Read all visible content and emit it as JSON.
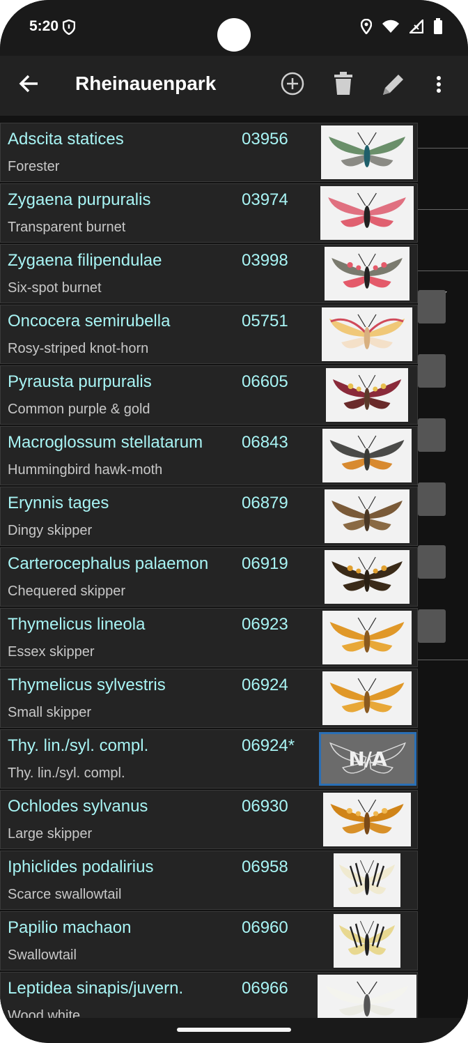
{
  "status": {
    "time": "5:20"
  },
  "toolbar": {
    "title": "Rheinauenpark"
  },
  "colors": {
    "accent_text": "#a8f4f4",
    "selection_border": "#2a6fb5"
  },
  "species": [
    {
      "scientific": "Adscita statices",
      "code": "03956",
      "common": "Forester",
      "image": "moth-green"
    },
    {
      "scientific": "Zygaena purpuralis",
      "code": "03974",
      "common": "Transparent burnet",
      "image": "moth-red"
    },
    {
      "scientific": "Zygaena filipendulae",
      "code": "03998",
      "common": "Six-spot burnet",
      "image": "moth-red-spots"
    },
    {
      "scientific": "Oncocera semirubella",
      "code": "05751",
      "common": "Rosy-striped knot-horn",
      "image": "moth-pink-yellow"
    },
    {
      "scientific": "Pyrausta purpuralis",
      "code": "06605",
      "common": "Common purple & gold",
      "image": "moth-purple-gold"
    },
    {
      "scientific": "Macroglossum stellatarum",
      "code": "06843",
      "common": "Hummingbird hawk-moth",
      "image": "moth-grey-brown"
    },
    {
      "scientific": "Erynnis tages",
      "code": "06879",
      "common": "Dingy skipper",
      "image": "skipper-brown"
    },
    {
      "scientific": "Carterocephalus palaemon",
      "code": "06919",
      "common": "Chequered skipper",
      "image": "skipper-chequered"
    },
    {
      "scientific": "Thymelicus lineola",
      "code": "06923",
      "common": "Essex skipper",
      "image": "skipper-orange"
    },
    {
      "scientific": "Thymelicus sylvestris",
      "code": "06924",
      "common": "Small skipper",
      "image": "skipper-orange"
    },
    {
      "scientific": "Thy. lin./syl. compl.",
      "code": "06924*",
      "common": "Thy. lin./syl. compl.",
      "image": "na",
      "na_label": "N/A"
    },
    {
      "scientific": "Ochlodes sylvanus",
      "code": "06930",
      "common": "Large skipper",
      "image": "skipper-orange-dark"
    },
    {
      "scientific": "Iphiclides podalirius",
      "code": "06958",
      "common": "Scarce swallowtail",
      "image": "swallowtail-striped"
    },
    {
      "scientific": "Papilio machaon",
      "code": "06960",
      "common": "Swallowtail",
      "image": "swallowtail-yellow"
    },
    {
      "scientific": "Leptidea sinapis/juvern.",
      "code": "06966",
      "common": "Wood white",
      "image": "white-butterfly"
    }
  ]
}
